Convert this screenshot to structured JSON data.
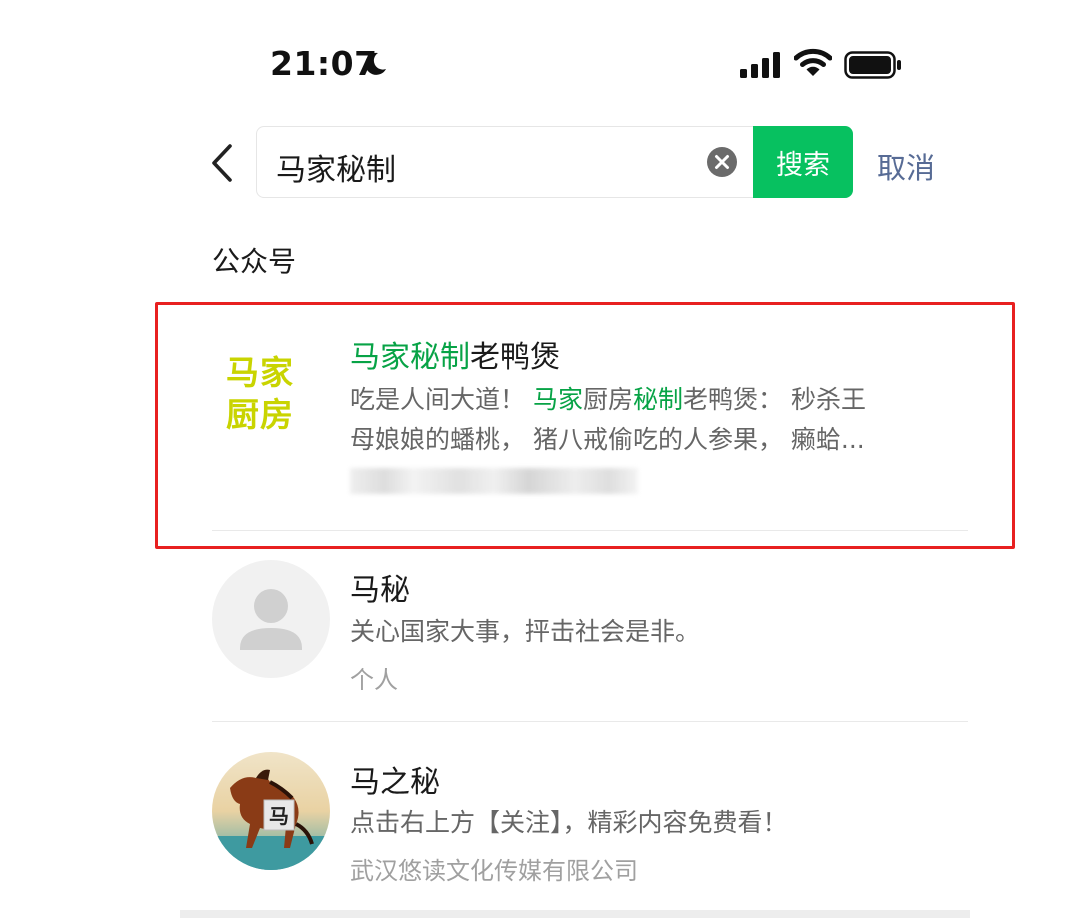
{
  "status_bar": {
    "time": "21:07"
  },
  "search": {
    "query": "马家秘制",
    "button_label": "搜索",
    "cancel_label": "取消"
  },
  "section": {
    "title": "公众号"
  },
  "results": [
    {
      "logo_lines": [
        "马家",
        "厨房"
      ],
      "name_highlight": "马家秘制",
      "name_rest": "老鸭煲",
      "desc_parts": [
        "吃是人间大道！",
        "马家",
        "厨房",
        "秘制",
        "老鸭煲：  秒杀王",
        "母娘娘的蟠桃，  猪八戒偷吃的人参果，  癞蛤..."
      ]
    },
    {
      "name": "马秘",
      "desc": "关心国家大事，抨击社会是非。",
      "sub": "个人"
    },
    {
      "name": "马之秘",
      "desc": "点击右上方【关注】，精彩内容免费看！",
      "sub": "武汉悠读文化传媒有限公司",
      "avatar_badge": "马"
    }
  ]
}
